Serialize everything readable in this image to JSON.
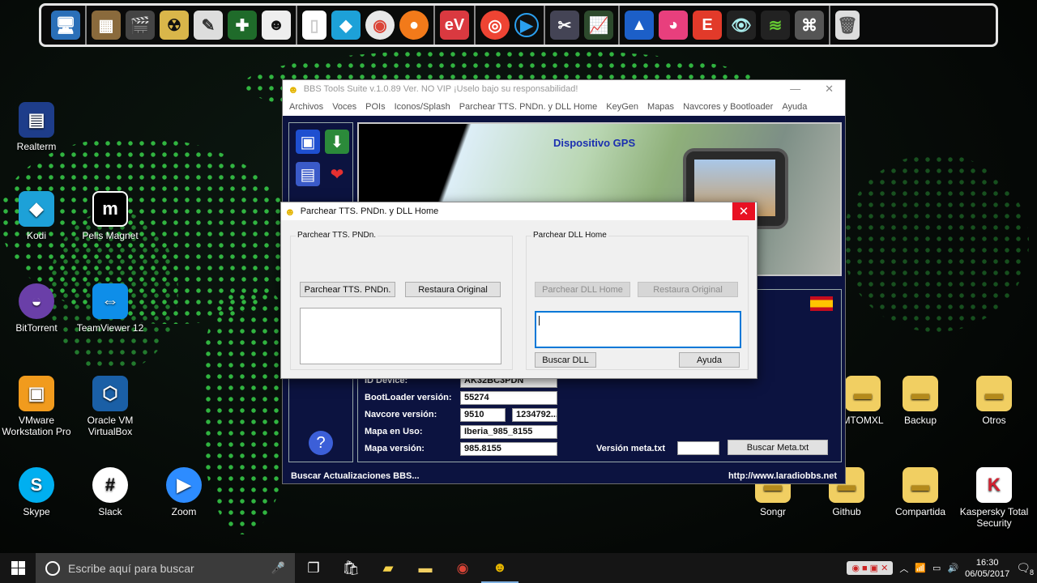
{
  "dock": {
    "icons": [
      "monitor-icon",
      "archive-box-icon",
      "clapperboard-icon",
      "radiation-icon",
      "feather-icon",
      "plus-shield-icon",
      "anonymous-mask-icon",
      "blank-page-icon",
      "kodi-icon",
      "chrome-icon",
      "firefox-icon",
      "expressvpn-icon",
      "cd-disc-icon",
      "play-circle-icon",
      "tools-icon",
      "task-monitor-icon",
      "shark-fin-icon",
      "piggy-icon",
      "ef-icon",
      "eye-icon",
      "wifi-icon",
      "router-icon",
      "recycle-bin-icon"
    ]
  },
  "desktop": {
    "left_icons": [
      {
        "label": "Realterm",
        "icon": "terminal-icon"
      },
      {
        "label": "Kodi",
        "icon": "kodi-icon"
      },
      {
        "label": "Pelis Magnet",
        "icon": "magnet-icon"
      },
      {
        "label": "BitTorrent",
        "icon": "bittorrent-icon"
      },
      {
        "label": "TeamViewer 12",
        "icon": "teamviewer-icon"
      },
      {
        "label": "VMware Workstation Pro",
        "icon": "vmware-icon"
      },
      {
        "label": "Oracle VM VirtualBox",
        "icon": "virtualbox-icon"
      },
      {
        "label": "Skype",
        "icon": "skype-icon"
      },
      {
        "label": "Slack",
        "icon": "slack-icon"
      },
      {
        "label": "Zoom",
        "icon": "zoom-icon"
      }
    ],
    "right_icons": [
      {
        "label": "MTOMXL",
        "icon": "folder-icon"
      },
      {
        "label": "Backup",
        "icon": "folder-icon"
      },
      {
        "label": "Otros",
        "icon": "folder-icon"
      },
      {
        "label": "Songr",
        "icon": "folder-icon"
      },
      {
        "label": "Github",
        "icon": "folder-icon"
      },
      {
        "label": "Compartida",
        "icon": "folder-icon"
      },
      {
        "label": "Kaspersky Total Security",
        "icon": "kaspersky-icon"
      }
    ]
  },
  "main_window": {
    "title": "BBS Tools Suite v.1.0.89  Ver. NO VIP  ¡Uselo bajo su responsabilidad!",
    "minimize": "—",
    "close": "✕",
    "menu": [
      "Archivos",
      "Voces",
      "POIs",
      "Iconos/Splash",
      "Parchear TTS. PNDn. y DLL Home",
      "KeyGen",
      "Mapas",
      "Navcores y Bootloader",
      "Ayuda"
    ],
    "banner_title": "Dispositivo GPS",
    "fields": {
      "id_device_label": "ID Device:",
      "id_device_value": "AK32BC3PDN",
      "bootloader_label": "BootLoader versión:",
      "bootloader_value": "55274",
      "navcore_label": "Navcore versión:",
      "navcore_value_1": "9510",
      "navcore_value_2": "1234792...",
      "mapa_uso_label": "Mapa en Uso:",
      "mapa_uso_value": "Iberia_985_8155",
      "mapa_version_label": "Mapa versión:",
      "mapa_version_value": "985.8155",
      "meta_label": "Versión meta.txt",
      "meta_value": "",
      "buscar_meta_button": "Buscar Meta.txt"
    },
    "status_left": "Buscar Actualizaciones BBS...",
    "status_right": "http://www.laradiobbs.net"
  },
  "dialog": {
    "title": "Parchear TTS. PNDn. y DLL Home",
    "close": "✕",
    "left_group": {
      "title": "Parchear TTS. PNDn.",
      "patch_button": "Parchear TTS. PNDn.",
      "restore_button": "Restaura Original"
    },
    "right_group": {
      "title": "Parchear DLL Home",
      "patch_button": "Parchear DLL Home",
      "restore_button": "Restaura Original",
      "search_button": "Buscar DLL",
      "help_button": "Ayuda"
    }
  },
  "taskbar": {
    "search_placeholder": "Escribe aquí para buscar",
    "apps": [
      "task-view-icon",
      "store-icon",
      "sticky-notes-icon",
      "file-explorer-icon",
      "chrome-icon",
      "bbs-tools-icon"
    ],
    "time": "16:30",
    "date": "06/05/2017",
    "notification_count": "8"
  },
  "colors": {
    "dots": "#38d24a",
    "window_bg": "#0c1340",
    "banner_title": "#1b2fb0",
    "close_red": "#e81123"
  }
}
